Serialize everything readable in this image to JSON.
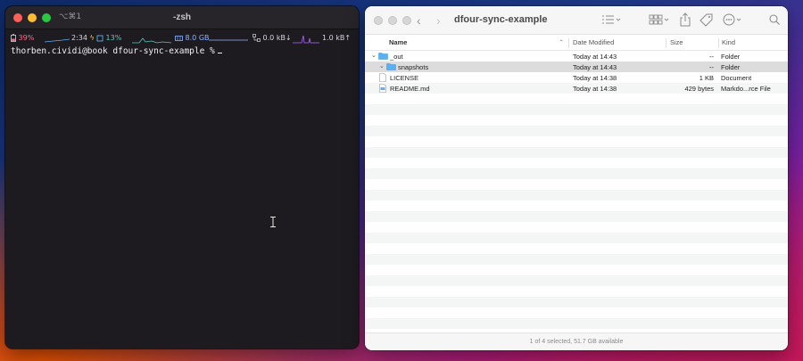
{
  "terminal": {
    "shortcut": "⌥⌘1",
    "title": "-zsh",
    "status": {
      "battery": "39%",
      "time_remaining": "2:34",
      "cpu": "13%",
      "memory": "8.0 GB",
      "net_down": "0.0 kB↓",
      "net_up": "1.0 kB↑"
    },
    "prompt": "thorben.cividi@book dfour-sync-example %"
  },
  "finder": {
    "title": "dfour-sync-example",
    "columns": {
      "name": "Name",
      "date": "Date Modified",
      "size": "Size",
      "kind": "Kind"
    },
    "rows": [
      {
        "name": "_out",
        "date": "Today at 14:43",
        "size": "--",
        "kind": "Folder",
        "icon": "folder-icon",
        "expanded": true
      },
      {
        "name": "snapshots",
        "date": "Today at 14:43",
        "size": "--",
        "kind": "Folder",
        "icon": "folder-icon",
        "expanded": true,
        "selected": true
      },
      {
        "name": "LICENSE",
        "date": "Today at 14:38",
        "size": "1 KB",
        "kind": "Document",
        "icon": "document-icon"
      },
      {
        "name": "README.md",
        "date": "Today at 14:38",
        "size": "429 bytes",
        "kind": "Markdo...rce File",
        "icon": "markdown-file-icon"
      }
    ],
    "footer": "1 of 4 selected, 51.7 GB available",
    "colors": {
      "folder": "#5ab0f0",
      "selection": "#dcdcdc",
      "alt_row": "#f4f5f5"
    }
  }
}
